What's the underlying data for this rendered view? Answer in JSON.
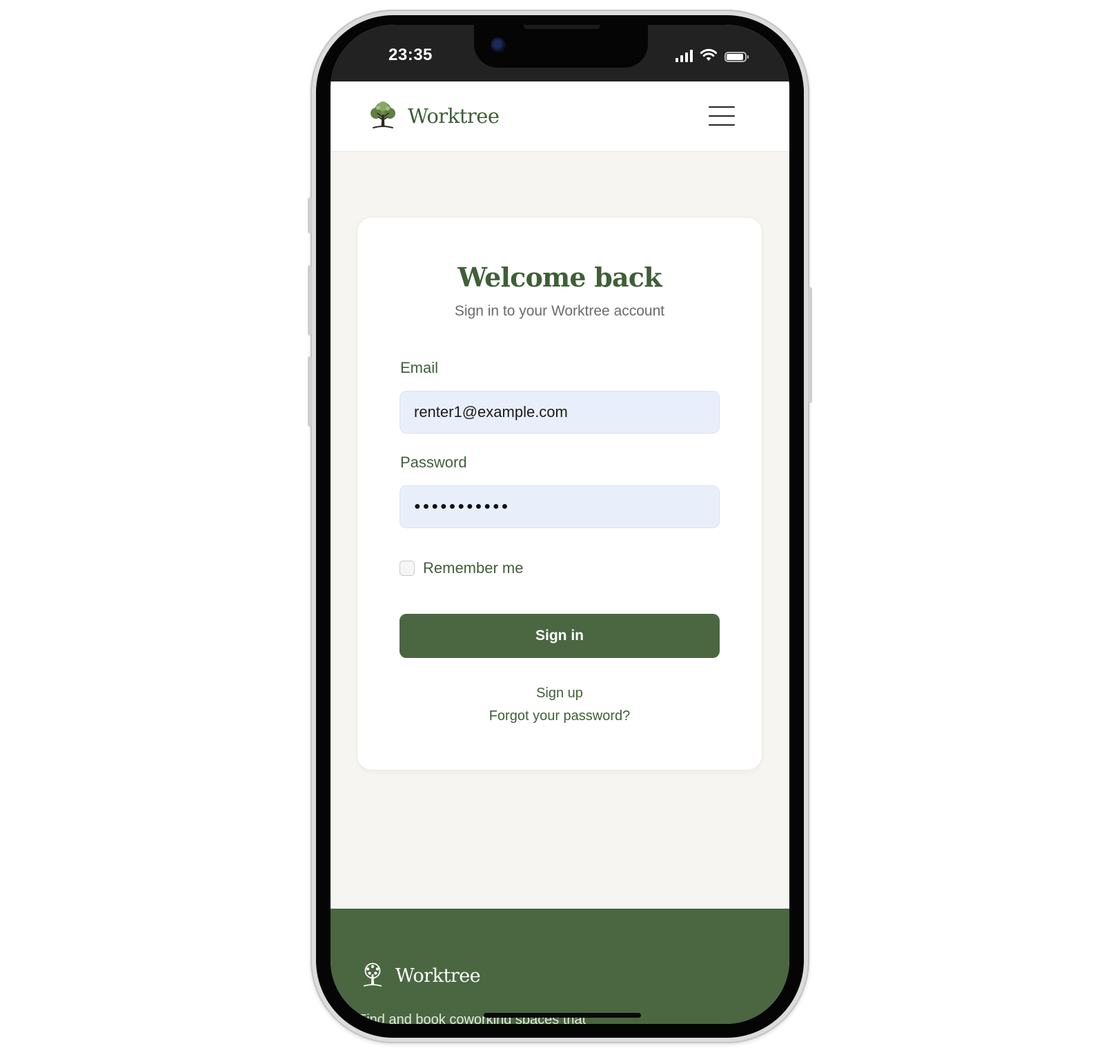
{
  "status_bar": {
    "time": "23:35"
  },
  "header": {
    "brand_name": "Worktree"
  },
  "login": {
    "title": "Welcome back",
    "subtitle": "Sign in to your Worktree account",
    "email_label": "Email",
    "email_value": "renter1@example.com",
    "password_label": "Password",
    "password_mask": "●●●●●●●●●●●",
    "remember_label": "Remember me",
    "remember_checked": false,
    "signin_label": "Sign in",
    "signup_link": "Sign up",
    "forgot_link": "Forgot your password?"
  },
  "footer": {
    "brand_name": "Worktree",
    "tagline": "Find and book coworking spaces that"
  },
  "colors": {
    "brand_green": "#4a6741",
    "heading_green": "#3f5f37",
    "input_bg": "#e8effb",
    "page_bg": "#f6f5f2"
  }
}
